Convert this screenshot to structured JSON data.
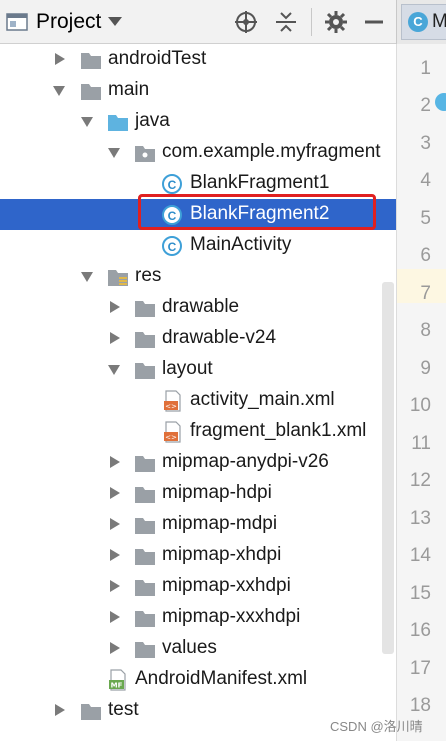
{
  "header": {
    "title": "Project",
    "icons": [
      "project-view-icon",
      "dropdown-icon",
      "locate-icon",
      "collapse-icon",
      "gear-icon",
      "minimize-icon"
    ]
  },
  "editor_tab": {
    "letter": "C",
    "label": "M"
  },
  "tree": {
    "rows": [
      {
        "label": "androidTest",
        "kind": "folder",
        "expanded": false
      },
      {
        "label": "main",
        "kind": "folder",
        "expanded": true
      },
      {
        "label": "java",
        "kind": "source-folder",
        "expanded": true
      },
      {
        "label": "com.example.myfragment",
        "kind": "package",
        "expanded": true
      },
      {
        "label": "BlankFragment1",
        "kind": "class"
      },
      {
        "label": "BlankFragment2",
        "kind": "class",
        "selected": true
      },
      {
        "label": "MainActivity",
        "kind": "class"
      },
      {
        "label": "res",
        "kind": "res-folder",
        "expanded": true
      },
      {
        "label": "drawable",
        "kind": "folder",
        "expanded": false
      },
      {
        "label": "drawable-v24",
        "kind": "folder",
        "expanded": false
      },
      {
        "label": "layout",
        "kind": "folder",
        "expanded": true
      },
      {
        "label": "activity_main.xml",
        "kind": "xml"
      },
      {
        "label": "fragment_blank1.xml",
        "kind": "xml"
      },
      {
        "label": "mipmap-anydpi-v26",
        "kind": "folder",
        "expanded": false
      },
      {
        "label": "mipmap-hdpi",
        "kind": "folder",
        "expanded": false
      },
      {
        "label": "mipmap-mdpi",
        "kind": "folder",
        "expanded": false
      },
      {
        "label": "mipmap-xhdpi",
        "kind": "folder",
        "expanded": false
      },
      {
        "label": "mipmap-xxhdpi",
        "kind": "folder",
        "expanded": false
      },
      {
        "label": "mipmap-xxxhdpi",
        "kind": "folder",
        "expanded": false
      },
      {
        "label": "values",
        "kind": "folder",
        "expanded": false
      },
      {
        "label": "AndroidManifest.xml",
        "kind": "manifest"
      },
      {
        "label": "test",
        "kind": "folder",
        "expanded": false
      }
    ]
  },
  "gutter": {
    "line_numbers": [
      "1",
      "2",
      "3",
      "4",
      "5",
      "6",
      "7",
      "8",
      "9",
      "10",
      "11",
      "12",
      "13",
      "14",
      "15",
      "16",
      "17",
      "18"
    ],
    "current_line": "7"
  },
  "watermark": "CSDN @洛川晴",
  "colors": {
    "selection": "#2f65ca",
    "highlight_box": "#e02020",
    "class_icon": "#3ea0d8"
  }
}
